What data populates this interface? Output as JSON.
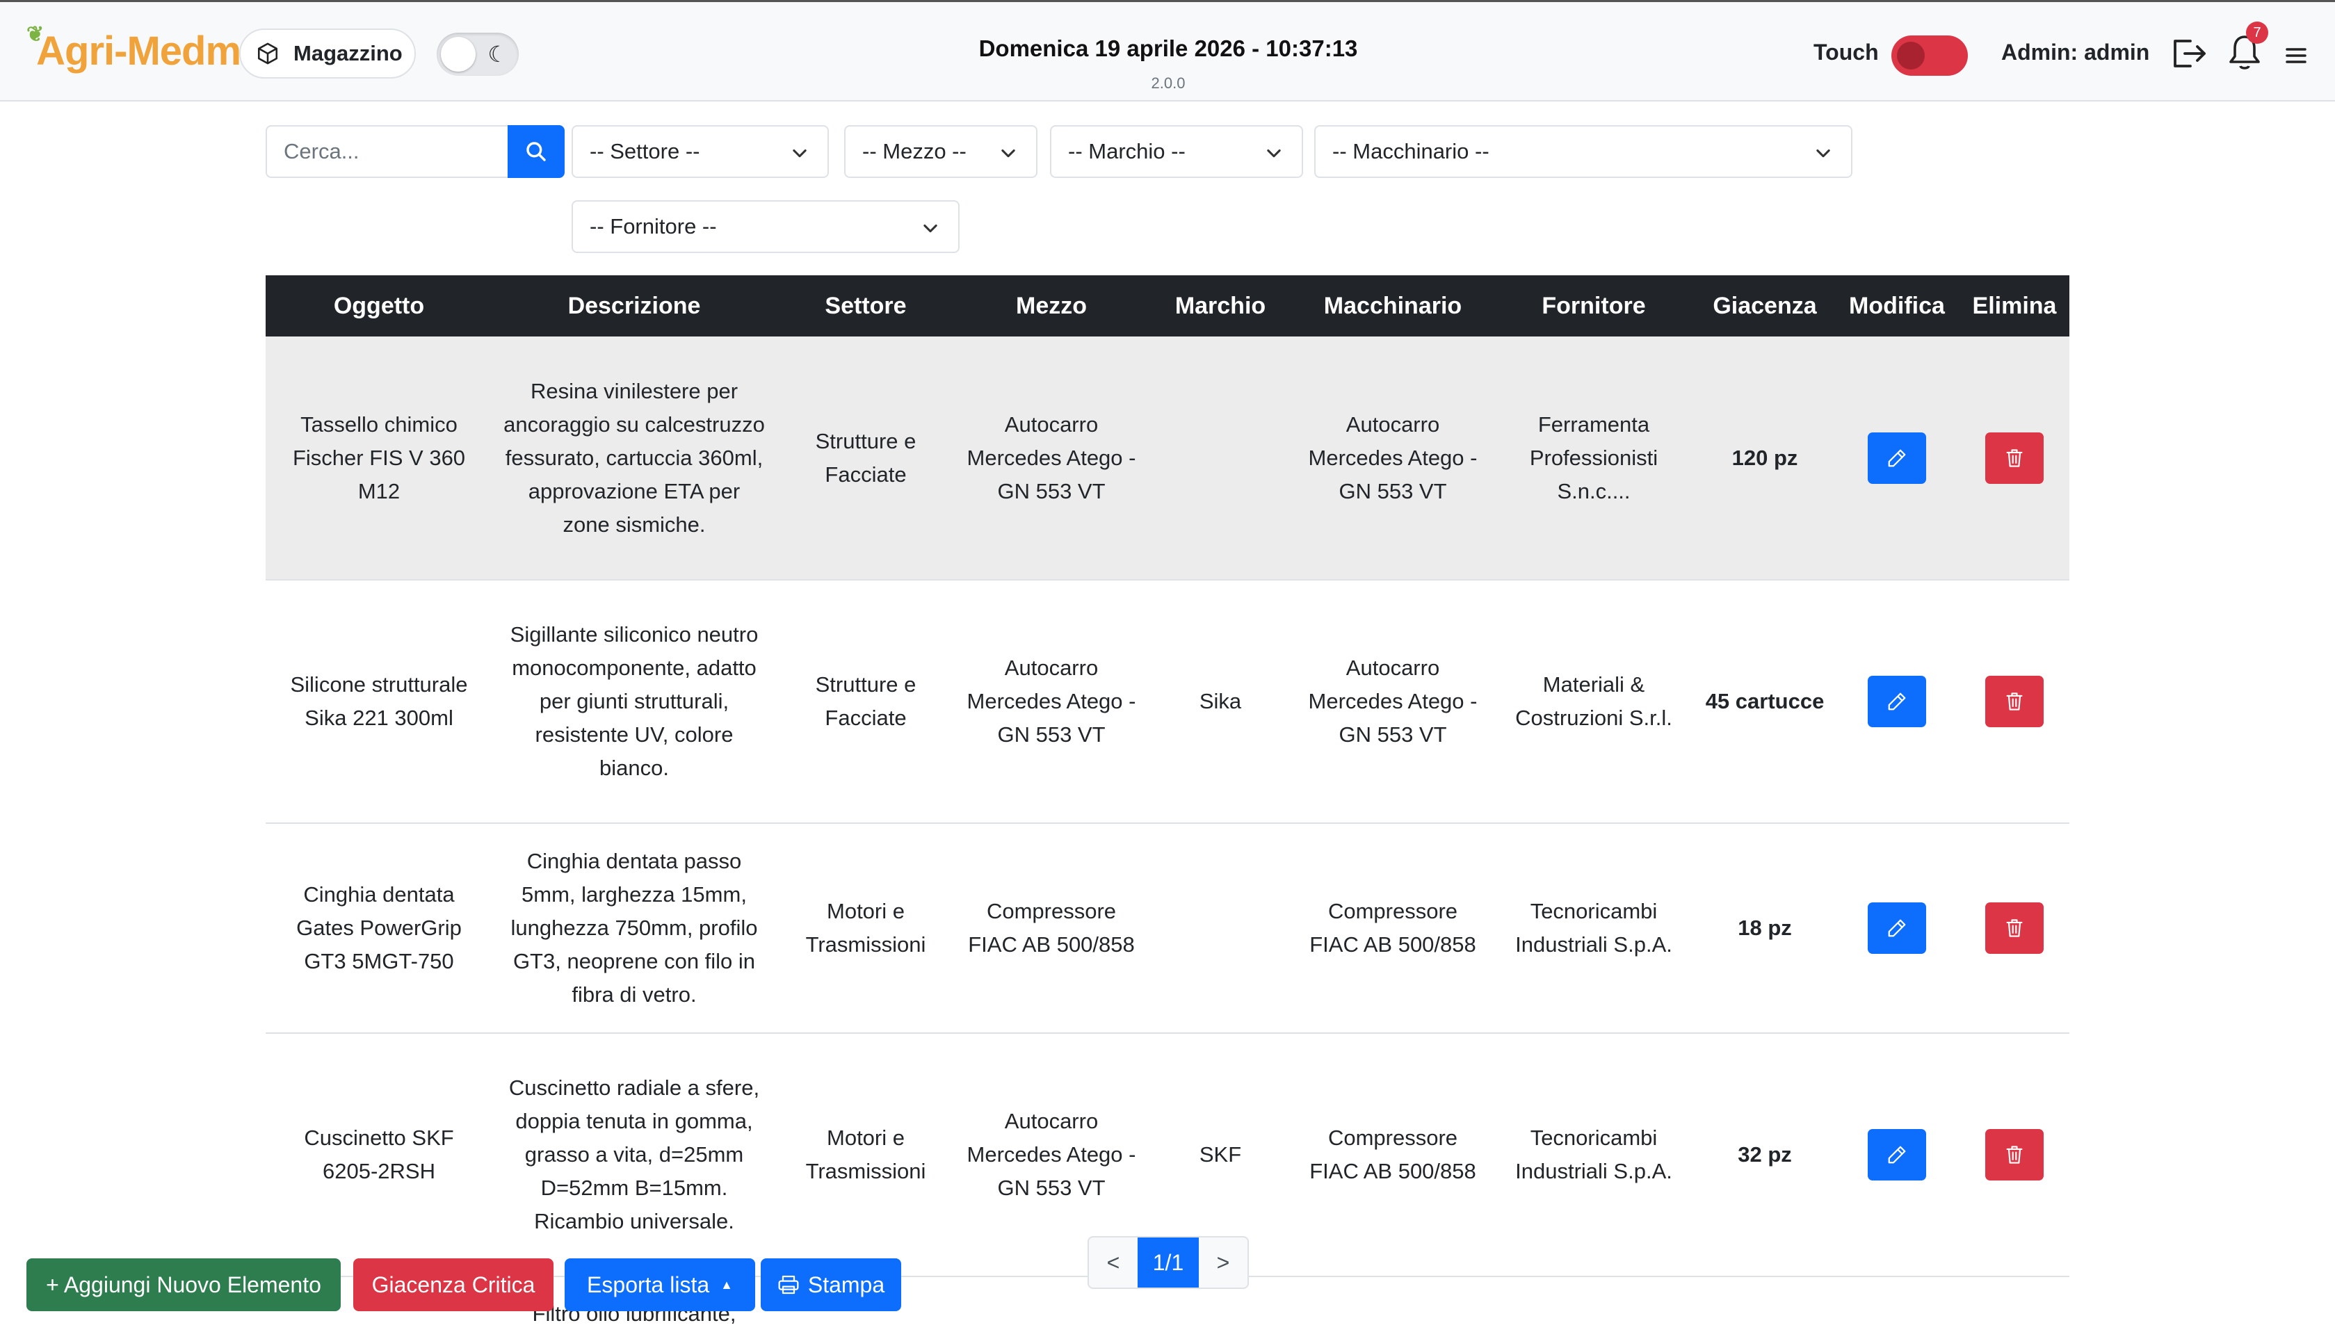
{
  "header": {
    "logo_text": "Agri-Medma",
    "module_label": "Magazzino",
    "datetime": "Domenica 19 aprile 2026 - 10:37:13",
    "version": "2.0.0",
    "touch_label": "Touch",
    "admin_label": "Admin: admin",
    "notification_count": "7",
    "icons": {
      "module": "cube-icon",
      "theme": "moon-icon",
      "logout": "logout-icon",
      "notifications": "bell-icon",
      "menu": "hamburger-icon"
    }
  },
  "filters": {
    "search_placeholder": "Cerca...",
    "settore": "-- Settore --",
    "mezzo": "-- Mezzo --",
    "marchio": "-- Marchio --",
    "macchinario": "-- Macchinario --",
    "fornitore": "-- Fornitore --"
  },
  "table": {
    "headers": [
      "Oggetto",
      "Descrizione",
      "Settore",
      "Mezzo",
      "Marchio",
      "Macchinario",
      "Fornitore",
      "Giacenza",
      "Modifica",
      "Elimina"
    ],
    "rows": [
      {
        "oggetto": "Tassello chimico Fischer FIS V 360 M12",
        "descrizione": "Resina vinilestere per ancoraggio su calcestruzzo fessurato, cartuccia 360ml, approvazione ETA per zone sismiche.",
        "settore": "Strutture e Facciate",
        "mezzo": "Autocarro Mercedes Atego - GN 553 VT",
        "marchio": "",
        "macchinario": "Autocarro Mercedes Atego - GN 553 VT",
        "fornitore": "Ferramenta Professionisti S.n.c....",
        "giacenza": "120 pz"
      },
      {
        "oggetto": "Silicone strutturale Sika 221 300ml",
        "descrizione": "Sigillante siliconico neutro monocomponente, adatto per giunti strutturali, resistente UV, colore bianco.",
        "settore": "Strutture e Facciate",
        "mezzo": "Autocarro Mercedes Atego - GN 553 VT",
        "marchio": "Sika",
        "macchinario": "Autocarro Mercedes Atego - GN 553 VT",
        "fornitore": "Materiali & Costruzioni S.r.l.",
        "giacenza": "45 cartucce"
      },
      {
        "oggetto": "Cinghia dentata Gates PowerGrip GT3 5MGT-750",
        "descrizione": "Cinghia dentata passo 5mm, larghezza 15mm, lunghezza 750mm, profilo GT3, neoprene con filo in fibra di vetro.",
        "settore": "Motori e Trasmissioni",
        "mezzo": "Compressore FIAC AB 500/858",
        "marchio": "",
        "macchinario": "Compressore FIAC AB 500/858",
        "fornitore": "Tecnoricambi Industriali S.p.A.",
        "giacenza": "18 pz"
      },
      {
        "oggetto": "Cuscinetto SKF 6205-2RSH",
        "descrizione": "Cuscinetto radiale a sfere, doppia tenuta in gomma, grasso a vita, d=25mm D=52mm B=15mm. Ricambio universale.",
        "settore": "Motori e Trasmissioni",
        "mezzo": "Autocarro Mercedes Atego - GN 553 VT",
        "marchio": "SKF",
        "macchinario": "Compressore FIAC AB 500/858",
        "fornitore": "Tecnoricambi Industriali S.p.A.",
        "giacenza": "32 pz"
      }
    ],
    "partial_next_row_text": "Filtro olio lubrificante,"
  },
  "actions": {
    "add": "+ Aggiungi Nuovo Elemento",
    "critical": "Giacenza Critica",
    "export": "Esporta lista",
    "print": "Stampa"
  },
  "pagination": {
    "prev": "<",
    "current": "1/1",
    "next": ">"
  },
  "colors": {
    "primary": "#0d6efd",
    "danger": "#dc3545",
    "success": "#2e7d4f",
    "header_dark": "#212529",
    "logo_orange": "#f0a23b"
  }
}
